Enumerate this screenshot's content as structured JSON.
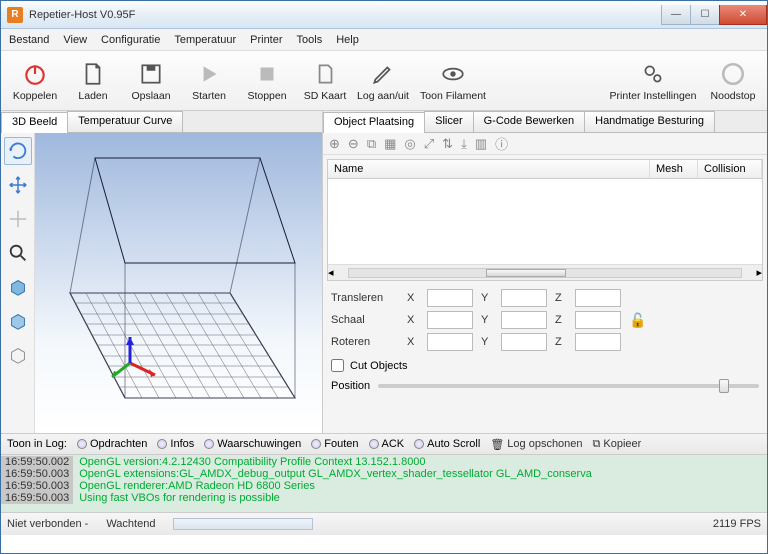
{
  "window": {
    "title": "Repetier-Host V0.95F"
  },
  "menu": [
    "Bestand",
    "View",
    "Configuratie",
    "Temperatuur",
    "Printer",
    "Tools",
    "Help"
  ],
  "toolbar": {
    "koppelen": "Koppelen",
    "laden": "Laden",
    "opslaan": "Opslaan",
    "starten": "Starten",
    "stoppen": "Stoppen",
    "sdkaart": "SD Kaart",
    "log": "Log aan/uit",
    "filament": "Toon Filament",
    "settings": "Printer Instellingen",
    "noodstop": "Noodstop"
  },
  "leftTabs": {
    "beeld": "3D Beeld",
    "temp": "Temperatuur Curve"
  },
  "rightTabs": {
    "placement": "Object Plaatsing",
    "slicer": "Slicer",
    "gcode": "G-Code Bewerken",
    "manual": "Handmatige Besturing"
  },
  "table": {
    "name": "Name",
    "mesh": "Mesh",
    "collision": "Collision"
  },
  "transform": {
    "transleren": "Transleren",
    "schaal": "Schaal",
    "roteren": "Roteren",
    "x": "X",
    "y": "Y",
    "z": "Z",
    "tx": "",
    "ty": "",
    "tz": "",
    "sx": "",
    "sy": "",
    "sz": "",
    "rx": "",
    "ry": "",
    "rz": ""
  },
  "cut": {
    "label": "Cut Objects",
    "position": "Position"
  },
  "logbar": {
    "prefix": "Toon in Log:",
    "opdrachten": "Opdrachten",
    "infos": "Infos",
    "waarschuwingen": "Waarschuwingen",
    "fouten": "Fouten",
    "ack": "ACK",
    "autoscroll": "Auto Scroll",
    "clear": "Log opschonen",
    "copy": "Kopieer"
  },
  "log": [
    {
      "ts": "16:59:50.002",
      "msg": "OpenGL version:4.2.12430 Compatibility Profile Context 13.152.1.8000"
    },
    {
      "ts": "16:59:50.003",
      "msg": "OpenGL extensions:GL_AMDX_debug_output GL_AMDX_vertex_shader_tessellator GL_AMD_conserva"
    },
    {
      "ts": "16:59:50.003",
      "msg": "OpenGL renderer:AMD Radeon HD 6800 Series"
    },
    {
      "ts": "16:59:50.003",
      "msg": "Using fast VBOs for rendering is possible"
    }
  ],
  "status": {
    "conn": "Niet verbonden - ",
    "wait": "Wachtend",
    "fps": "2119 FPS"
  }
}
